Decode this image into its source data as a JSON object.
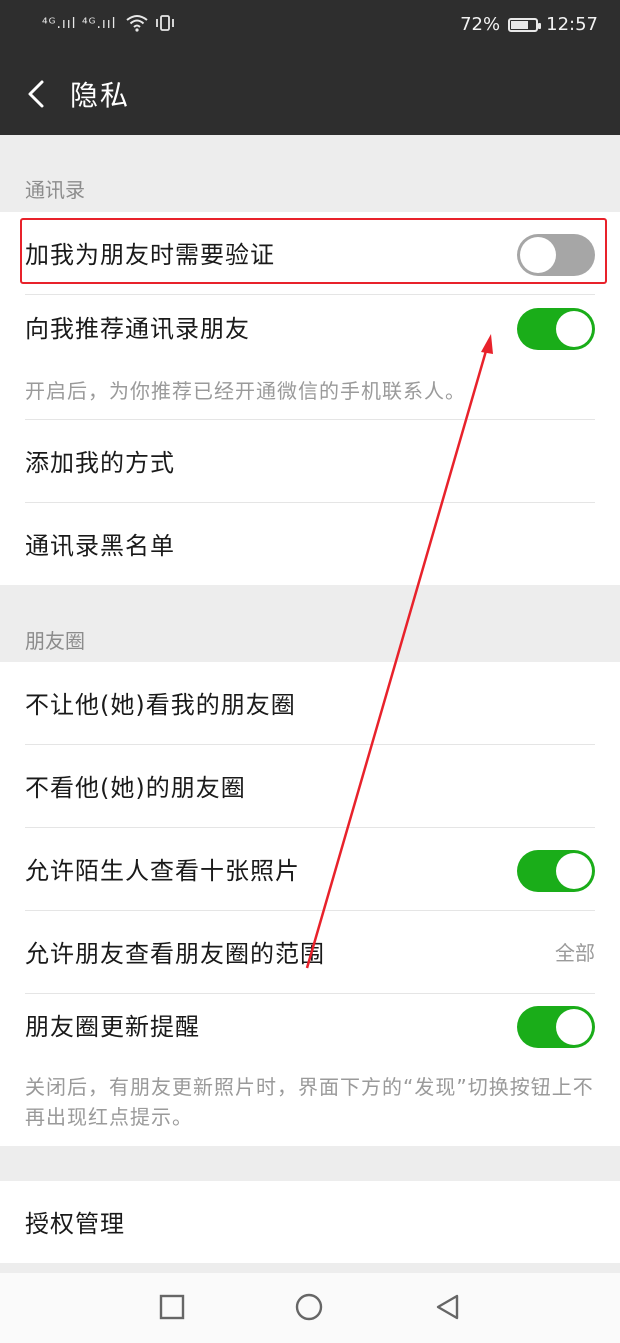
{
  "status_bar": {
    "signal_text": "⁴ᴳ.ııl ⁴ᴳ.ııl",
    "battery_percent": "72%",
    "battery_level": 0.72,
    "time": "12:57"
  },
  "header": {
    "title": "隐私"
  },
  "contacts_section": {
    "label": "通讯录",
    "items": [
      {
        "label": "加我为朋友时需要验证",
        "toggle": "off"
      },
      {
        "label": "向我推荐通讯录朋友",
        "toggle": "on"
      },
      {
        "label": "添加我的方式"
      },
      {
        "label": "通讯录黑名单"
      }
    ],
    "hint": "开启后，为你推荐已经开通微信的手机联系人。"
  },
  "moments_section": {
    "label": "朋友圈",
    "items": [
      {
        "label": "不让他(她)看我的朋友圈"
      },
      {
        "label": "不看他(她)的朋友圈"
      },
      {
        "label": "允许陌生人查看十张照片",
        "toggle": "on"
      },
      {
        "label": "允许朋友查看朋友圈的范围",
        "value": "全部"
      },
      {
        "label": "朋友圈更新提醒",
        "toggle": "on"
      }
    ],
    "hint": "关闭后，有朋友更新照片时，界面下方的“发现”切换按钮上不再出现红点提示。"
  },
  "auth_section": {
    "items": [
      {
        "label": "授权管理"
      }
    ]
  },
  "colors": {
    "toggle_on": "#1aad19",
    "toggle_off": "#a6a6a6",
    "annotation": "#e8222b",
    "header_bg": "#2e2e2e"
  },
  "icons": {
    "back": "chevron-left-icon",
    "nav_recent": "square-icon",
    "nav_home": "circle-icon",
    "nav_back": "triangle-back-icon"
  }
}
